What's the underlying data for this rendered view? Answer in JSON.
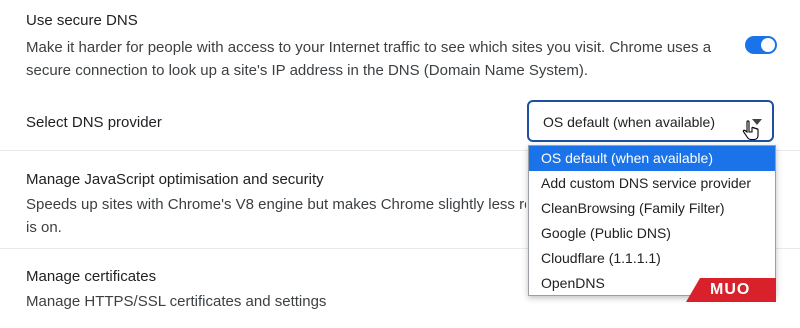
{
  "secure_dns": {
    "title": "Use secure DNS",
    "desc": "Make it harder for people with access to your Internet traffic to see which sites you visit. Chrome uses a secure connection to look up a site's IP address in the DNS (Domain Name System).",
    "toggle_on": true,
    "accent_color": "#1a73e8"
  },
  "dns_provider": {
    "label": "Select DNS provider",
    "selected": "OS default (when available)",
    "options": [
      "OS default (when available)",
      "Add custom DNS service provider",
      "CleanBrowsing (Family Filter)",
      "Google (Public DNS)",
      "Cloudflare (1.1.1.1)",
      "OpenDNS"
    ]
  },
  "javascript": {
    "title": "Manage JavaScript optimisation and security",
    "desc": "Speeds up sites with Chrome's V8 engine but makes Chrome slightly less re",
    "desc_line2": "is on."
  },
  "certificates": {
    "title": "Manage certificates",
    "desc": "Manage HTTPS/SSL certificates and settings"
  },
  "watermark": {
    "text": "MUO"
  }
}
